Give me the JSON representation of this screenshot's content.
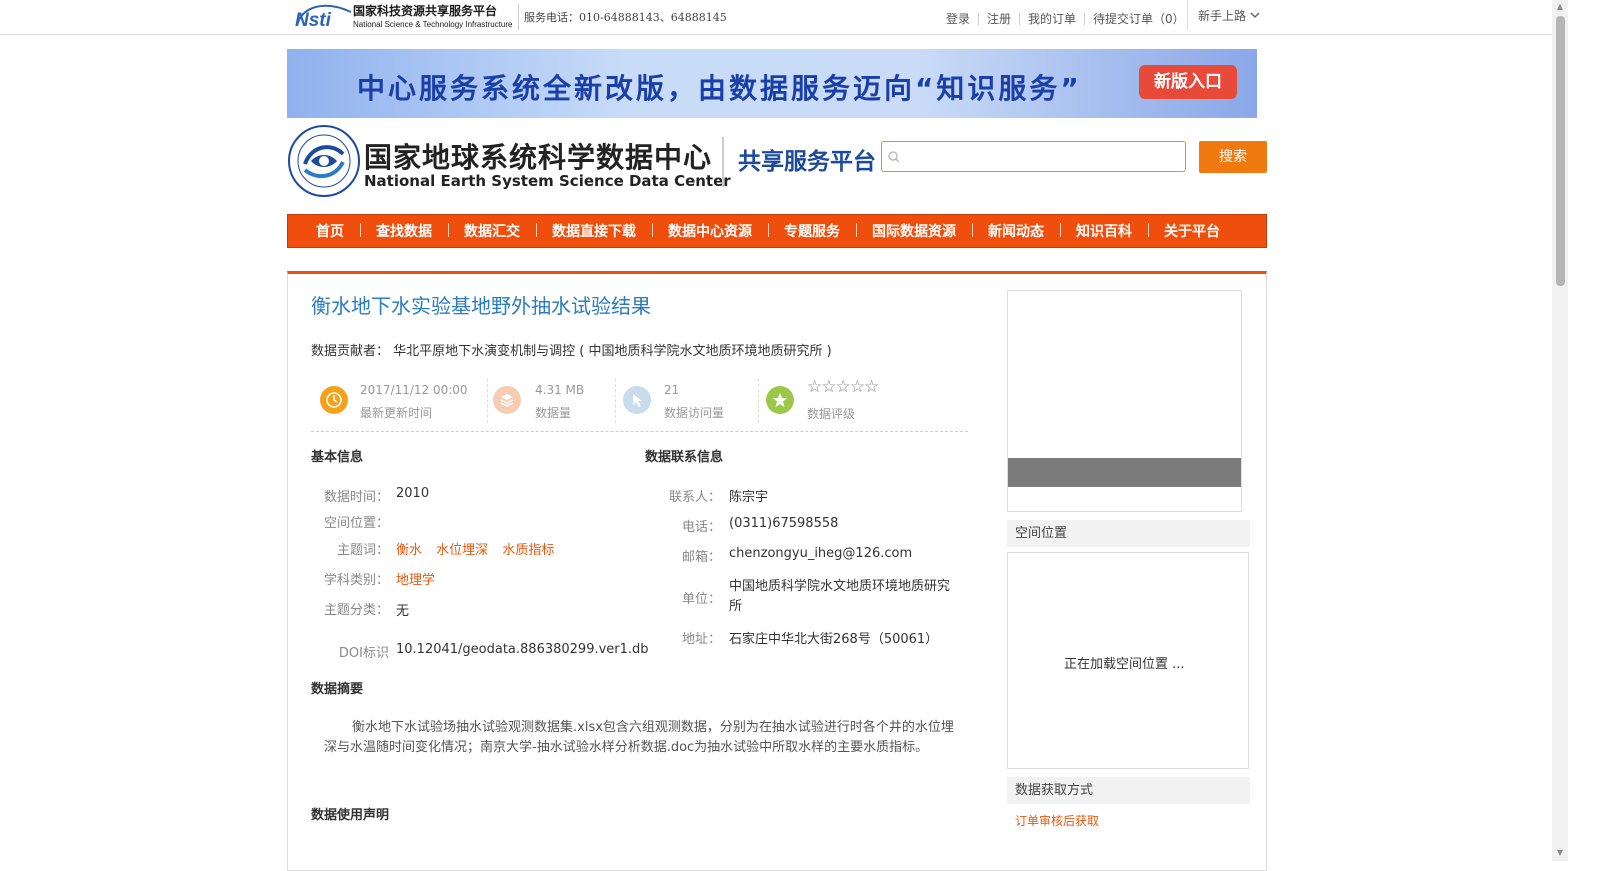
{
  "topbar": {
    "logo_main": "国家科技资源共享服务平台",
    "logo_en": "National Science & Technology Infrastructure",
    "logo_mark": "Nsti",
    "hotline": "服务电话：010-64888143、64888145",
    "links": [
      "登录",
      "注册",
      "我的订单",
      "待提交订单（0）"
    ],
    "newbie": "新手上路"
  },
  "banner": {
    "text": "中心服务系统全新改版，由数据服务迈向“知识服务”",
    "button": "新版入口"
  },
  "header": {
    "center_name": "国家地球系统科学数据中心",
    "center_en": "National Earth System Science Data Center",
    "platform": "共享服务平台",
    "search_placeholder": "",
    "search_button": "搜索"
  },
  "nav": [
    "首页",
    "查找数据",
    "数据汇交",
    "数据直接下载",
    "数据中心资源",
    "专题服务",
    "国际数据资源",
    "新闻动态",
    "知识百科",
    "关于平台"
  ],
  "dataset": {
    "title": "衡水地下水实验基地野外抽水试验结果",
    "contributor_label": "数据贡献者：",
    "contributor": "华北平原地下水演变机制与调控 ( 中国地质科学院水文地质环境地质研究所 )",
    "stats": {
      "updated_value": "2017/11/12 00:00",
      "updated_label": "最新更新时间",
      "size_value": "4.31 MB",
      "size_label": "数据量",
      "visits_value": "21",
      "visits_label": "数据访问量",
      "rating_stars": "☆☆☆☆☆",
      "rating_value": 0,
      "rating_label": "数据评级"
    },
    "basic_info_head": "基本信息",
    "basic": {
      "time_label": "数据时间：",
      "time_value": "2010",
      "space_label": "空间位置：",
      "space_value": "",
      "keywords_label": "主题词：",
      "keywords": [
        "衡水",
        "水位埋深",
        "水质指标"
      ],
      "discipline_label": "学科类别：",
      "discipline": "地理学",
      "category_label": "主题分类：",
      "category": "无",
      "doi_label": "DOI标识",
      "doi": "10.12041/geodata.886380299.ver1.db"
    },
    "contact_head": "数据联系信息",
    "contact": {
      "person_label": "联系人：",
      "person": "陈宗宇",
      "phone_label": "电话：",
      "phone": "(0311)67598558",
      "email_label": "邮箱：",
      "email": "chenzongyu_iheg@126.com",
      "unit_label": "单位：",
      "unit": "中国地质科学院水文地质环境地质研究所",
      "address_label": "地址：",
      "address": "石家庄中华北大街268号（50061）"
    },
    "abstract_head": "数据摘要",
    "abstract": "衡水地下水试验场抽水试验观测数据集.xlsx包含六组观测数据，分别为在抽水试验进行时各个井的水位埋深与水温随时间变化情况；南京大学-抽水试验水样分析数据.doc为抽水试验中所取水样的主要水质指标。",
    "usage_head": "数据使用声明"
  },
  "sidebar": {
    "space_head": "空间位置",
    "map_loading": "正在加载空间位置 ...",
    "acquire_head": "数据获取方式",
    "acquire_link": "订单审核后获取"
  },
  "colors": {
    "accent": "#f04e0c",
    "title_blue": "#2b7cc1",
    "tag_orange": "#e8590c"
  }
}
